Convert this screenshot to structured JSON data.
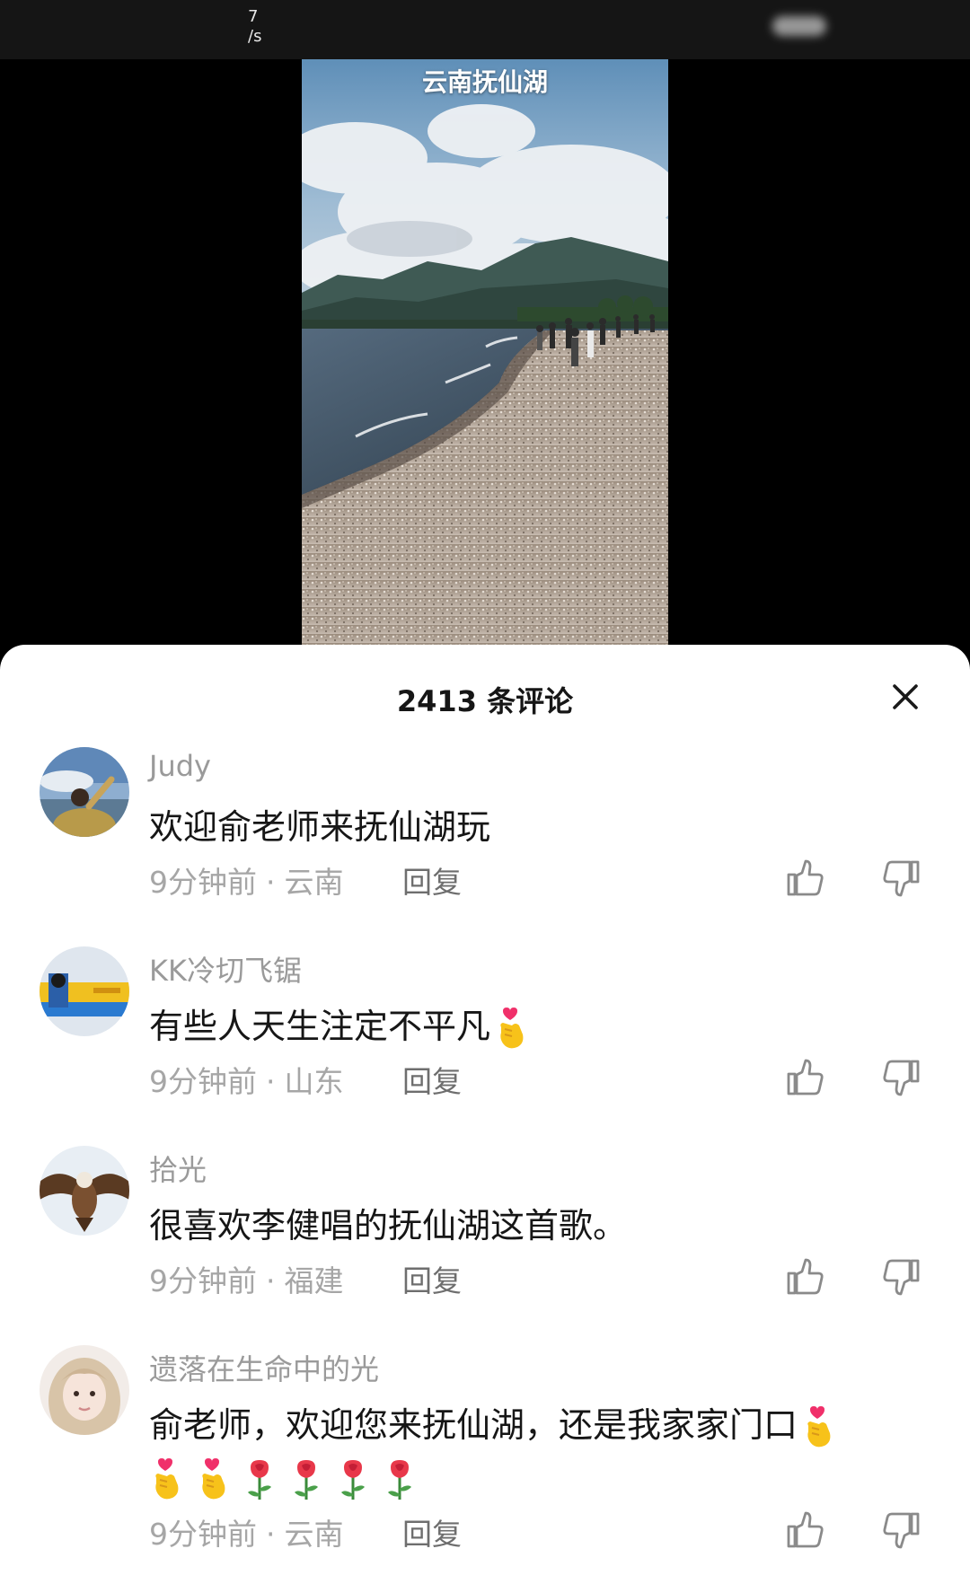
{
  "status_bar": {
    "net_speed_value": "7",
    "net_speed_unit": "/s"
  },
  "video": {
    "overlay_title": "云南抚仙湖"
  },
  "comments_panel": {
    "count_label": "2413 条评论",
    "comments": [
      {
        "username": "Judy",
        "text": "欢迎俞老师来抚仙湖玩",
        "time": "9分钟前",
        "location": "云南",
        "reply_label": "回复"
      },
      {
        "username": "KK冷切飞锯",
        "text": "有些人天生注定不平凡",
        "time": "9分钟前",
        "location": "山东",
        "reply_label": "回复"
      },
      {
        "username": "拾光",
        "text": "很喜欢李健唱的抚仙湖这首歌。",
        "time": "9分钟前",
        "location": "福建",
        "reply_label": "回复"
      },
      {
        "username": "遗落在生命中的光",
        "text": "俞老师，欢迎您来抚仙湖，还是我家家门口",
        "time": "9分钟前",
        "location": "云南",
        "reply_label": "回复"
      }
    ]
  },
  "separator_dot": "·",
  "icons": {
    "close": "close-icon",
    "like": "thumbs-up-icon",
    "dislike": "thumbs-down-icon",
    "finger_heart": "finger-heart-emoji",
    "rose": "rose-emoji"
  }
}
